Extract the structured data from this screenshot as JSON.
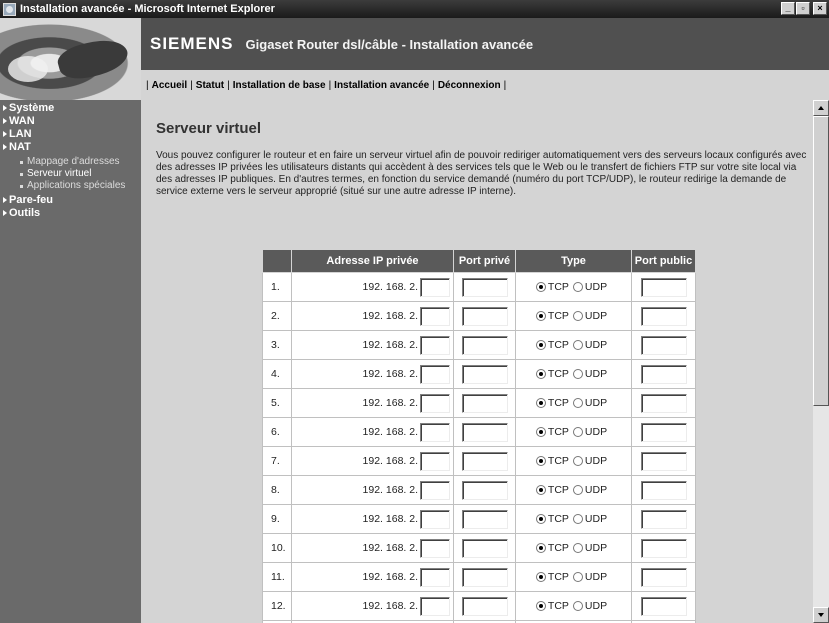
{
  "window": {
    "title": "Installation avancée - Microsoft Internet Explorer",
    "buttons": {
      "minimize": "_",
      "maximize": "▫",
      "close": "×"
    }
  },
  "header": {
    "brand": "SIEMENS",
    "product_title": "Gigaset Router dsl/câble  -  Installation avancée"
  },
  "navbar": {
    "items": [
      {
        "label": "Accueil"
      },
      {
        "label": "Statut"
      },
      {
        "label": "Installation de base"
      },
      {
        "label": "Installation avancée"
      },
      {
        "label": "Déconnexion"
      }
    ]
  },
  "sidebar": {
    "items": [
      {
        "label": "Système"
      },
      {
        "label": "WAN"
      },
      {
        "label": "LAN"
      },
      {
        "label": "NAT"
      },
      {
        "label": "Mappage d'adresses"
      },
      {
        "label": "Serveur virtuel"
      },
      {
        "label": "Applications spéciales"
      },
      {
        "label": "Pare-feu"
      },
      {
        "label": "Outils"
      }
    ]
  },
  "main": {
    "page_title": "Serveur virtuel",
    "description": "Vous pouvez configurer le routeur et en faire un serveur virtuel afin de pouvoir rediriger automatiquement vers des serveurs locaux configurés avec des adresses IP privées les utilisateurs distants qui accèdent à des services tels que le Web ou le transfert de fichiers FTP sur votre site local via des adresses IP publiques. En d'autres termes, en fonction du service demandé (numéro du port TCP/UDP), le routeur redirige la demande de service externe vers le serveur approprié (situé sur une autre adresse IP interne).",
    "table": {
      "headers": [
        "",
        "Adresse IP privée",
        "Port privé",
        "Type",
        "Port public"
      ],
      "ip_prefix": "192. 168. 2.",
      "tcp_label": "TCP",
      "udp_label": "UDP",
      "rows": [
        {
          "num": "1.",
          "ip_suffix": "",
          "private_port": "",
          "type": "TCP",
          "public_port": ""
        },
        {
          "num": "2.",
          "ip_suffix": "",
          "private_port": "",
          "type": "TCP",
          "public_port": ""
        },
        {
          "num": "3.",
          "ip_suffix": "",
          "private_port": "",
          "type": "TCP",
          "public_port": ""
        },
        {
          "num": "4.",
          "ip_suffix": "",
          "private_port": "",
          "type": "TCP",
          "public_port": ""
        },
        {
          "num": "5.",
          "ip_suffix": "",
          "private_port": "",
          "type": "TCP",
          "public_port": ""
        },
        {
          "num": "6.",
          "ip_suffix": "",
          "private_port": "",
          "type": "TCP",
          "public_port": ""
        },
        {
          "num": "7.",
          "ip_suffix": "",
          "private_port": "",
          "type": "TCP",
          "public_port": ""
        },
        {
          "num": "8.",
          "ip_suffix": "",
          "private_port": "",
          "type": "TCP",
          "public_port": ""
        },
        {
          "num": "9.",
          "ip_suffix": "",
          "private_port": "",
          "type": "TCP",
          "public_port": ""
        },
        {
          "num": "10.",
          "ip_suffix": "",
          "private_port": "",
          "type": "TCP",
          "public_port": ""
        },
        {
          "num": "11.",
          "ip_suffix": "",
          "private_port": "",
          "type": "TCP",
          "public_port": ""
        },
        {
          "num": "12.",
          "ip_suffix": "",
          "private_port": "",
          "type": "TCP",
          "public_port": ""
        },
        {
          "num": "",
          "ip_suffix": "",
          "private_port": "",
          "type": "",
          "public_port": ""
        }
      ]
    }
  }
}
